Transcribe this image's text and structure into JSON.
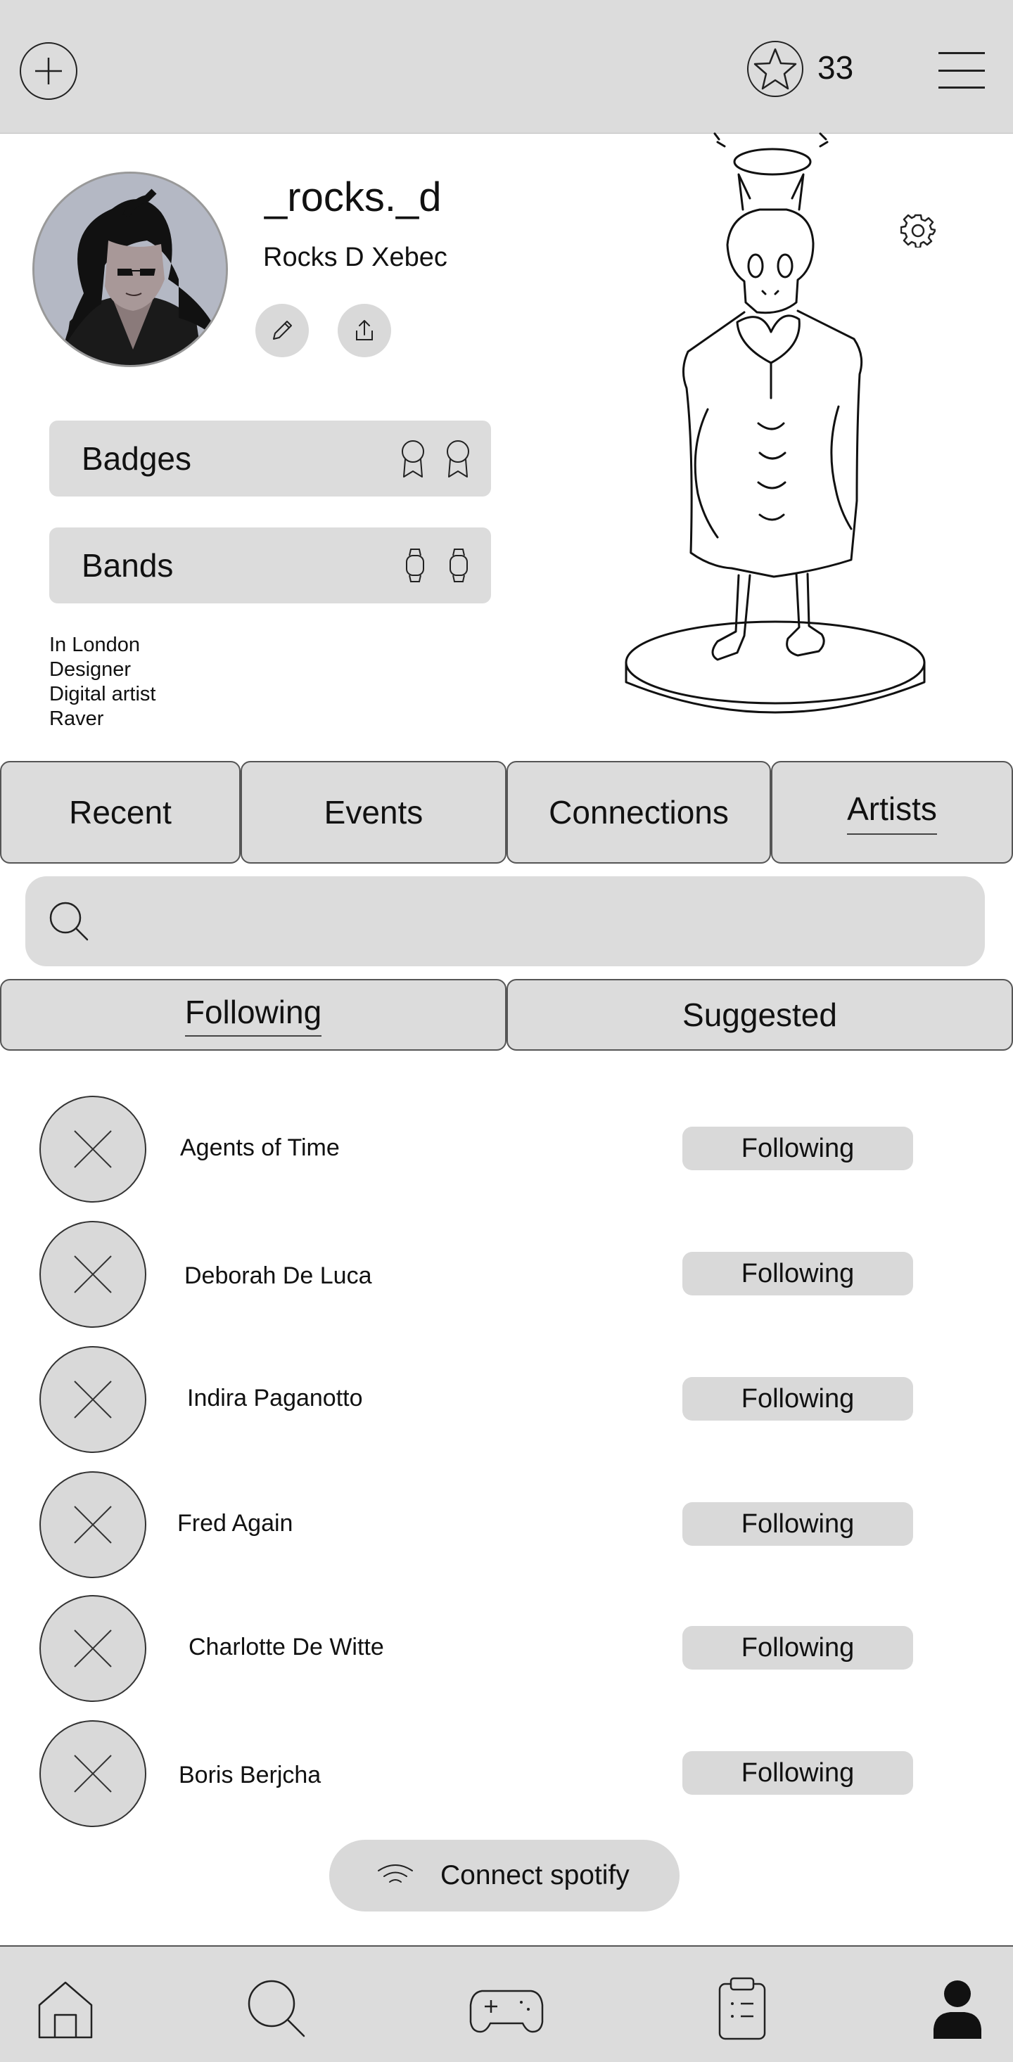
{
  "header": {
    "add_icon": "circle-plus-icon",
    "star_icon": "star-icon",
    "star_count": "33",
    "menu_icon": "hamburger-menu-icon"
  },
  "profile": {
    "username": "_rocks._d",
    "full_name": "Rocks D Xebec",
    "edit_icon": "pencil-icon",
    "share_icon": "share-icon",
    "settings_icon": "gear-icon",
    "badges_label": "Badges",
    "bands_label": "Bands",
    "bio": [
      "In London",
      "Designer",
      "Digital artist",
      "Raver"
    ]
  },
  "tabs": [
    {
      "label": "Recent"
    },
    {
      "label": "Events"
    },
    {
      "label": "Connections"
    },
    {
      "label": "Artists",
      "active": true
    }
  ],
  "search": {
    "placeholder": "",
    "value": ""
  },
  "subtabs": [
    {
      "label": "Following",
      "active": true
    },
    {
      "label": "Suggested"
    }
  ],
  "artists": [
    {
      "name": "Agents of Time",
      "status": "Following"
    },
    {
      "name": "Deborah De Luca",
      "status": "Following"
    },
    {
      "name": "Indira Paganotto",
      "status": "Following"
    },
    {
      "name": "Fred Again",
      "status": "Following"
    },
    {
      "name": "Charlotte De Witte",
      "status": "Following"
    },
    {
      "name": "Boris Berjcha",
      "status": "Following"
    }
  ],
  "spotify": {
    "label": "Connect spotify",
    "icon": "wifi-signal-icon"
  },
  "nav": [
    {
      "icon": "home-icon"
    },
    {
      "icon": "search-icon"
    },
    {
      "icon": "gamepad-icon"
    },
    {
      "icon": "clipboard-icon"
    },
    {
      "icon": "user-icon",
      "active": true
    }
  ],
  "colors": {
    "panel": "#dcdcdc",
    "button": "#d9d9d9",
    "text": "#111111",
    "avatar_bg": "#b4b8c4"
  }
}
